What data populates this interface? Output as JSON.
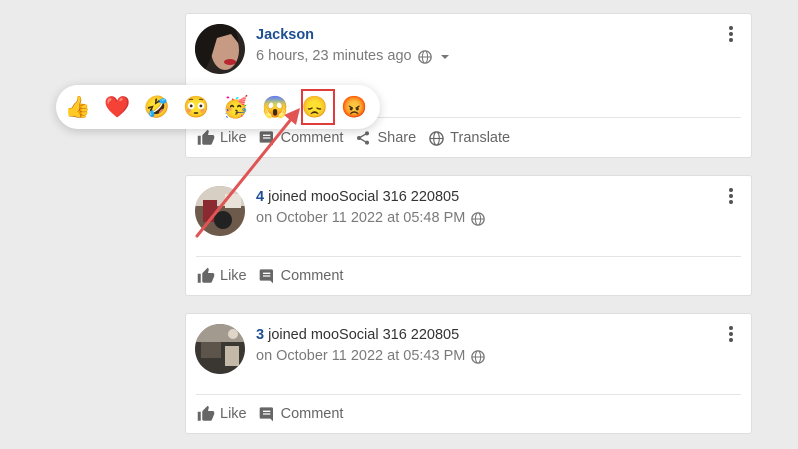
{
  "posts": [
    {
      "author": "Jackson",
      "time": "6 hours, 23 minutes ago",
      "actions": {
        "like": "Like",
        "comment": "Comment",
        "share": "Share",
        "translate": "Translate"
      }
    },
    {
      "subject": "4",
      "text": "joined mooSocial 316 220805",
      "time": "on October 11 2022 at 05:48 PM",
      "actions": {
        "like": "Like",
        "comment": "Comment"
      }
    },
    {
      "subject": "3",
      "text": "joined mooSocial 316 220805",
      "time": "on October 11 2022 at 05:43 PM",
      "actions": {
        "like": "Like",
        "comment": "Comment"
      }
    }
  ],
  "reactions": [
    {
      "name": "like",
      "glyph": "👍"
    },
    {
      "name": "love",
      "glyph": "❤️"
    },
    {
      "name": "haha",
      "glyph": "🤣"
    },
    {
      "name": "wow",
      "glyph": "😳"
    },
    {
      "name": "cool",
      "glyph": "🥳"
    },
    {
      "name": "scared",
      "glyph": "😱"
    },
    {
      "name": "sad",
      "glyph": "😞"
    },
    {
      "name": "angry",
      "glyph": "😡"
    }
  ],
  "colors": {
    "link": "#1d4f91",
    "annotation": "#e03c3c"
  }
}
